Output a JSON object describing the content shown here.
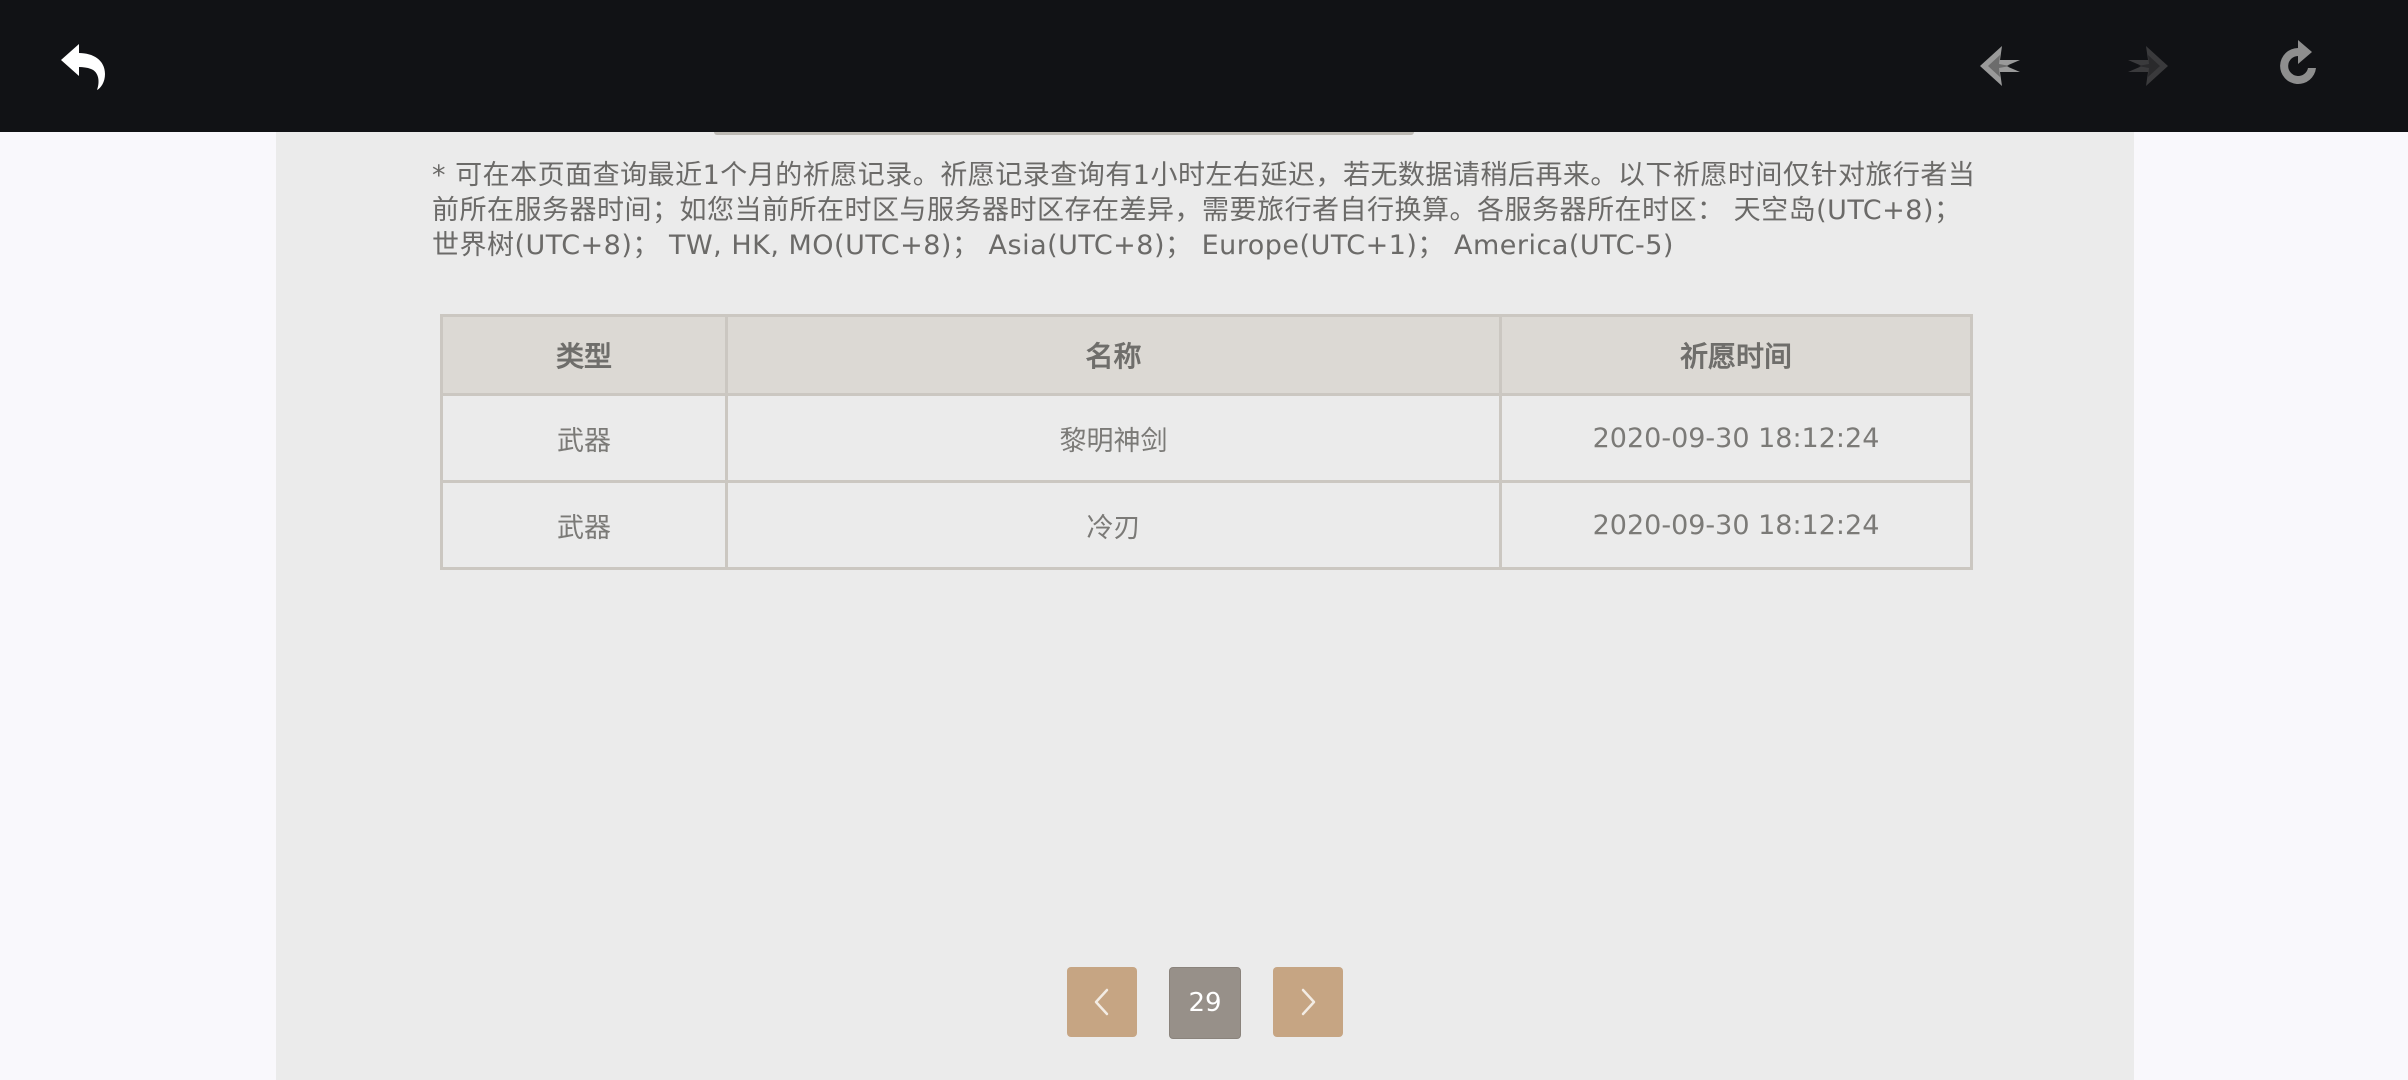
{
  "topbar": {
    "icons": {
      "back": "back-arrow-icon",
      "prev": "nav-prev-icon",
      "next": "nav-next-icon",
      "refresh": "refresh-icon"
    }
  },
  "notice": {
    "text": "* 可在本页面查询最近1个月的祈愿记录。祈愿记录查询有1小时左右延迟，若无数据请稍后再来。以下祈愿时间仅针对旅行者当前所在服务器时间；如您当前所在时区与服务器时区存在差异，需要旅行者自行换算。各服务器所在时区： 天空岛(UTC+8)； 世界树(UTC+8)； TW, HK, MO(UTC+8)； Asia(UTC+8)； Europe(UTC+1)； America(UTC-5)"
  },
  "table": {
    "headers": [
      "类型",
      "名称",
      "祈愿时间"
    ],
    "rows": [
      [
        "武器",
        "黎明神剑",
        "2020-09-30 18:12:24"
      ],
      [
        "武器",
        "冷刃",
        "2020-09-30 18:12:24"
      ]
    ]
  },
  "pagination": {
    "prev_icon": "chevron-left-icon",
    "current_page": "29",
    "next_icon": "chevron-right-icon"
  },
  "colors": {
    "topbar_bg": "#111215",
    "panel_bg": "#ebebeb",
    "header_bg": "#dcd9d4",
    "pager_arrow": "#c6a583",
    "pager_current": "#979089"
  }
}
